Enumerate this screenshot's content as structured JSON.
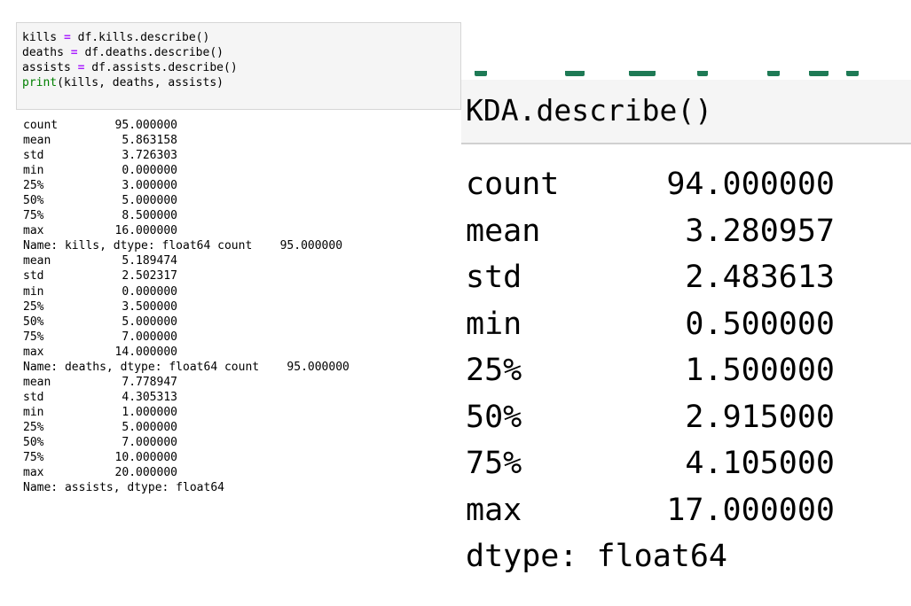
{
  "left": {
    "code": {
      "line1": {
        "var": "kills",
        "op": "=",
        "rest": "df.kills.describe()"
      },
      "line2": {
        "var": "deaths",
        "op": "=",
        "rest": "df.deaths.describe()"
      },
      "line3": {
        "var": "assists",
        "op": "=",
        "rest": "df.assists.describe()"
      },
      "line4": {
        "fn": "print",
        "args": "(kills, deaths, assists)"
      }
    },
    "kills": {
      "rows": [
        {
          "k": "count",
          "v": "95.000000"
        },
        {
          "k": "mean",
          "v": "5.863158"
        },
        {
          "k": "std",
          "v": "3.726303"
        },
        {
          "k": "min",
          "v": "0.000000"
        },
        {
          "k": "25%",
          "v": "3.000000"
        },
        {
          "k": "50%",
          "v": "5.000000"
        },
        {
          "k": "75%",
          "v": "8.500000"
        },
        {
          "k": "max",
          "v": "16.000000"
        }
      ],
      "name_line": "Name: kills, dtype: float64 count    95.000000"
    },
    "deaths": {
      "rows": [
        {
          "k": "mean",
          "v": "5.189474"
        },
        {
          "k": "std",
          "v": "2.502317"
        },
        {
          "k": "min",
          "v": "0.000000"
        },
        {
          "k": "25%",
          "v": "3.500000"
        },
        {
          "k": "50%",
          "v": "5.000000"
        },
        {
          "k": "75%",
          "v": "7.000000"
        },
        {
          "k": "max",
          "v": "14.000000"
        }
      ],
      "name_line": "Name: deaths, dtype: float64 count    95.000000"
    },
    "assists": {
      "rows": [
        {
          "k": "mean",
          "v": "7.778947"
        },
        {
          "k": "std",
          "v": "4.305313"
        },
        {
          "k": "min",
          "v": "1.000000"
        },
        {
          "k": "25%",
          "v": "5.000000"
        },
        {
          "k": "50%",
          "v": "7.000000"
        },
        {
          "k": "75%",
          "v": "10.000000"
        },
        {
          "k": "max",
          "v": "20.000000"
        }
      ],
      "name_line": "Name: assists, dtype: float64"
    },
    "colors": {
      "operator": "#aa22ff",
      "builtin": "#008000",
      "cell_bg": "#f5f5f5"
    }
  },
  "right": {
    "code": "KDA.describe()",
    "rows": [
      {
        "k": "count",
        "v": "94.000000"
      },
      {
        "k": "mean",
        "v": "3.280957"
      },
      {
        "k": "std",
        "v": "2.483613"
      },
      {
        "k": "min",
        "v": "0.500000"
      },
      {
        "k": "25%",
        "v": "1.500000"
      },
      {
        "k": "50%",
        "v": "2.915000"
      },
      {
        "k": "75%",
        "v": "4.105000"
      },
      {
        "k": "max",
        "v": "17.000000"
      }
    ],
    "dtype_line": "dtype: float64",
    "colors": {
      "cut_text": "#1e7a55",
      "cell_bg": "#f5f5f5"
    }
  }
}
